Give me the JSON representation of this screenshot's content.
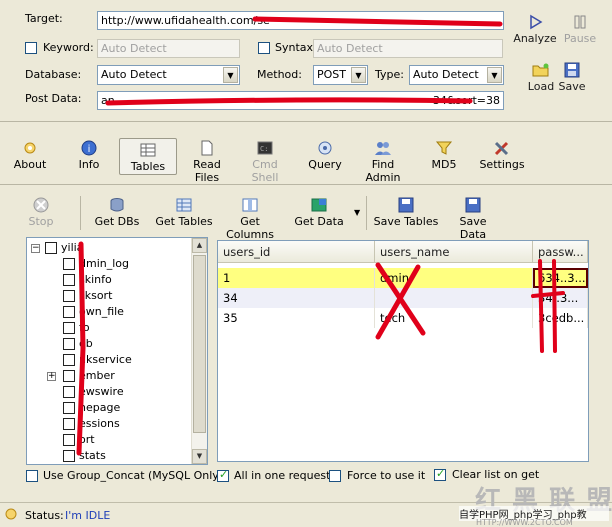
{
  "form": {
    "target_label": "Target:",
    "target_value": "http://www.ufidahealth.com/se",
    "keyword_label": "Keyword:",
    "keyword_placeholder": "Auto Detect",
    "syntax_label": "Syntax:",
    "syntax_placeholder": "Auto Detect",
    "database_label": "Database:",
    "database_value": "Auto Detect",
    "method_label": "Method:",
    "method_value": "POST",
    "type_label": "Type:",
    "type_value": "Auto Detect",
    "postdata_label": "Post Data:",
    "postdata_value": "an",
    "postdata_tail": "34&sort=38"
  },
  "side_buttons": {
    "analyze": "Analyze",
    "pause": "Pause",
    "load": "Load",
    "save": "Save"
  },
  "tabs": [
    {
      "label": "About"
    },
    {
      "label": "Info"
    },
    {
      "label": "Tables"
    },
    {
      "label": "Read Files"
    },
    {
      "label": "Cmd Shell"
    },
    {
      "label": "Query"
    },
    {
      "label": "Find Admin"
    },
    {
      "label": "MD5"
    },
    {
      "label": "Settings"
    }
  ],
  "toolbar": {
    "stop": "Stop",
    "get_dbs": "Get DBs",
    "get_tables": "Get Tables",
    "get_columns": "Get Columns",
    "get_data": "Get Data",
    "save_tables": "Save Tables",
    "save_data": "Save Data"
  },
  "tree": {
    "root": "yilia",
    "items": [
      "dmin_log",
      "skinfo",
      "sksort",
      "own_file",
      "fo",
      "ob",
      "nkservice",
      "ember",
      "ewswire",
      "nepage",
      "essions",
      "ort",
      "stats"
    ]
  },
  "grid": {
    "columns": [
      "users_id",
      "users_name",
      "passw..."
    ],
    "rows": [
      [
        "1",
        "dmin",
        "634..3..."
      ],
      [
        "34",
        "",
        "34..3..."
      ],
      [
        "35",
        "tech",
        "3cedb..."
      ]
    ]
  },
  "options": {
    "group_concat": "Use Group_Concat (MySQL Only)",
    "all_in_one": "All in one request.",
    "force": "Force to use it",
    "clear_list": "Clear list on get"
  },
  "status": {
    "label": "Status:",
    "value": "I'm IDLE"
  },
  "watermark": {
    "logo": "红 黑 联 盟",
    "text": "自学PHP网_php学习_php教",
    "url": "HTTP://WWW.2CTO.COM"
  },
  "colors": {
    "accent_selected_row": "#ffff80",
    "annotation_red": "#e0001a",
    "status_value": "#1f3fb8"
  }
}
